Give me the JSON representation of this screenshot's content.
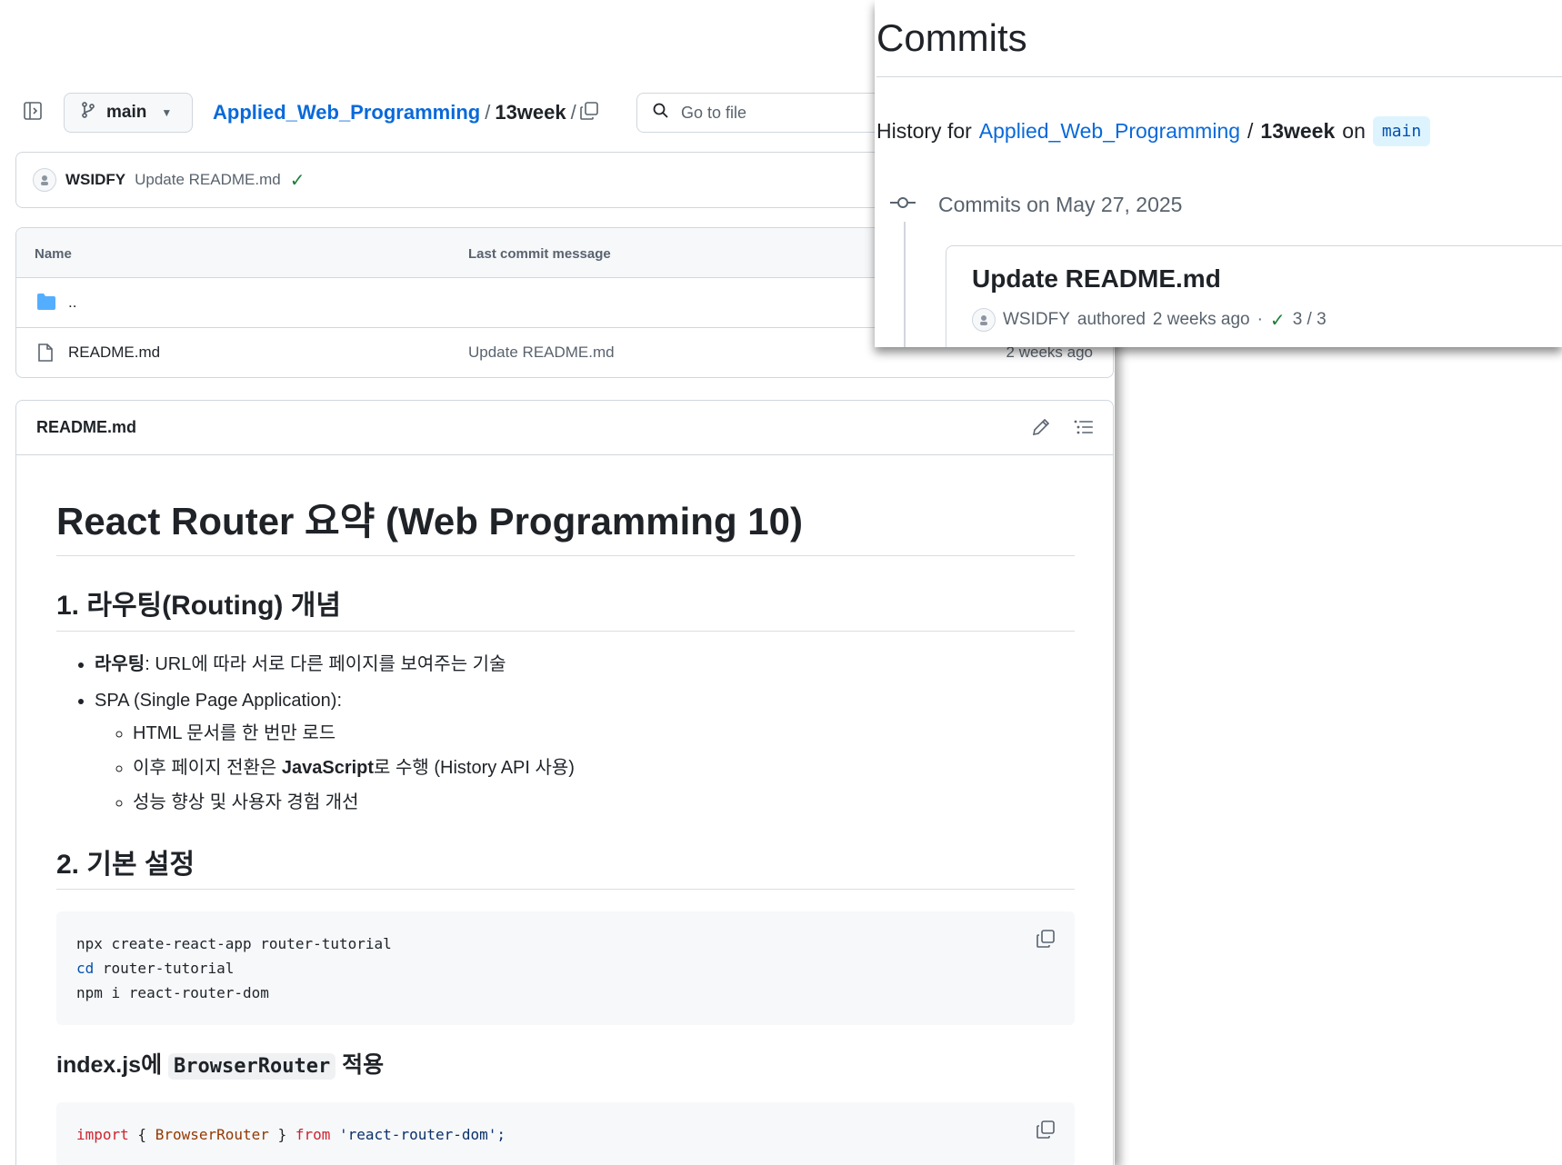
{
  "repo_view": {
    "branch": "main",
    "breadcrumb": {
      "repo": "Applied_Web_Programming",
      "separator": "/",
      "folder": "13week",
      "trailing_separator": "/"
    },
    "search_placeholder": "Go to file",
    "latest_commit": {
      "author": "WSIDFY",
      "message": "Update README.md",
      "status": "success"
    },
    "table": {
      "columns": [
        "Name",
        "Last commit message"
      ],
      "rows": [
        {
          "type": "folder",
          "name": "..",
          "message": "",
          "date": ""
        },
        {
          "type": "file",
          "name": "README.md",
          "message": "Update README.md",
          "date": "2 weeks ago"
        }
      ]
    }
  },
  "readme": {
    "filename": "README.md",
    "h1": "React Router 요약 (Web Programming 10)",
    "section1": {
      "title": "1. 라우팅(Routing) 개념",
      "item1_bold": "라우팅",
      "item1_text": ": URL에 따라 서로 다른 페이지를 보여주는 기술",
      "item2": "SPA (Single Page Application):",
      "sub1": "HTML 문서를 한 번만 로드",
      "sub2_before": "이후 페이지 전환은 ",
      "sub2_bold": "JavaScript",
      "sub2_after": "로 수행 (History API 사용)",
      "sub3": "성능 향상 및 사용자 경험 개선"
    },
    "section2": {
      "title": "2. 기본 설정",
      "code_line1": "npx create-react-app router-tutorial",
      "code_line2_cmd": "cd",
      "code_line2_arg": " router-tutorial",
      "code_line3": "npm i react-router-dom"
    },
    "section3": {
      "title_before": "index.js에 ",
      "title_code": "BrowserRouter",
      "title_after": " 적용",
      "code_import": "import",
      "code_braces_open": " { ",
      "code_name": "BrowserRouter",
      "code_braces_close": " } ",
      "code_from": "from",
      "code_module": " 'react-router-dom';"
    }
  },
  "commits_panel": {
    "title": "Commits",
    "history_prefix": "History for",
    "repo": "Applied_Web_Programming",
    "separator": "/",
    "folder": "13week",
    "on": "on",
    "branch": "main",
    "group_label": "Commits on May 27, 2025",
    "commit": {
      "title": "Update README.md",
      "author": "WSIDFY",
      "authored": "authored",
      "time": "2 weeks ago",
      "dot": "·",
      "checks": "3 / 3"
    }
  },
  "colors": {
    "link": "#0969da",
    "success": "#1a7f37",
    "border": "#d0d7de",
    "muted": "#59636e"
  }
}
